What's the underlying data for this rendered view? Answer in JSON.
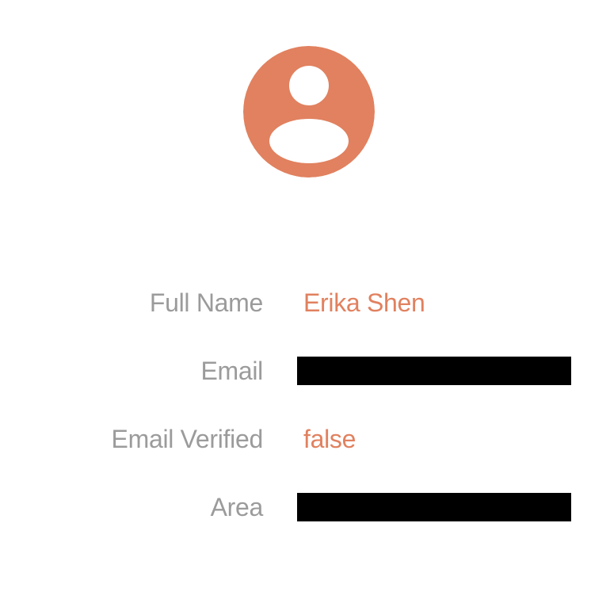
{
  "colors": {
    "accent": "#e1815f",
    "label": "#9b9b9b",
    "redaction": "#000000"
  },
  "avatar": {
    "icon": "account-circle-icon"
  },
  "profile": {
    "full_name": {
      "label": "Full Name",
      "value": "Erika Shen"
    },
    "email": {
      "label": "Email",
      "value": ""
    },
    "email_verified": {
      "label": "Email Verified",
      "value": "false"
    },
    "area": {
      "label": "Area",
      "value": ""
    }
  }
}
